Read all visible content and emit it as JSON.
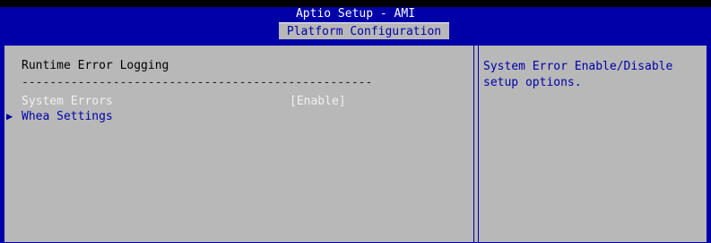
{
  "header": {
    "title": "Aptio Setup - AMI",
    "active_tab": "Platform Configuration"
  },
  "main": {
    "heading": "Runtime Error Logging",
    "separator": "--------------------------------------------------",
    "items": [
      {
        "label": "System Errors",
        "value": "[Enable]"
      },
      {
        "label": "Whea Settings",
        "arrow": "▶"
      }
    ]
  },
  "help": {
    "text": "System Error Enable/Disable\nsetup options."
  },
  "colors": {
    "background": "#0000a8",
    "panel": "#b8b8b8",
    "highlight_text": "#f0f0f0",
    "submenu_text": "#0000a8"
  }
}
